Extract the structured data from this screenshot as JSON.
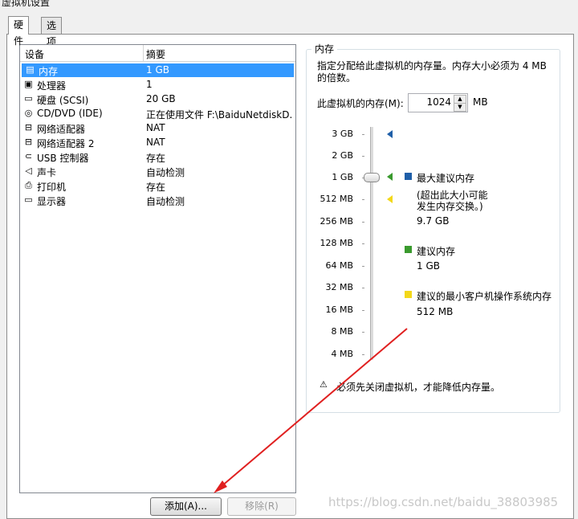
{
  "window": {
    "title": "虚拟机设置"
  },
  "tabs": [
    {
      "label": "硬件",
      "active": true
    },
    {
      "label": "选项",
      "active": false
    }
  ],
  "device_list": {
    "headers": {
      "device": "设备",
      "summary": "摘要"
    },
    "rows": [
      {
        "icon": "memory-icon",
        "name": "内存",
        "summary": "1 GB",
        "selected": true
      },
      {
        "icon": "processor-icon",
        "name": "处理器",
        "summary": "1"
      },
      {
        "icon": "hard-disk-icon",
        "name": "硬盘 (SCSI)",
        "summary": "20 GB"
      },
      {
        "icon": "cd-dvd-icon",
        "name": "CD/DVD (IDE)",
        "summary": "正在使用文件 F:\\BaiduNetdiskD..."
      },
      {
        "icon": "network-adapter-icon",
        "name": "网络适配器",
        "summary": "NAT"
      },
      {
        "icon": "network-adapter-icon",
        "name": "网络适配器 2",
        "summary": "NAT"
      },
      {
        "icon": "usb-icon",
        "name": "USB 控制器",
        "summary": "存在"
      },
      {
        "icon": "speaker-icon",
        "name": "声卡",
        "summary": "自动检测"
      },
      {
        "icon": "printer-icon",
        "name": "打印机",
        "summary": "存在"
      },
      {
        "icon": "monitor-icon",
        "name": "显示器",
        "summary": "自动检测"
      }
    ]
  },
  "buttons": {
    "add": "添加(A)...",
    "remove": "移除(R)"
  },
  "memory": {
    "group_title": "内存",
    "description_line1": "指定分配给此虚拟机的内存量。内存大小必须为 4 MB",
    "description_line2": "的倍数。",
    "field_label": "此虚拟机的内存(M):",
    "value": "1024",
    "unit": "MB",
    "scale_labels": [
      "3 GB",
      "2 GB",
      "1 GB",
      "512 MB",
      "256 MB",
      "128 MB",
      "64 MB",
      "32 MB",
      "16 MB",
      "8 MB",
      "4 MB"
    ],
    "max_recommended": {
      "label": "最大建议内存",
      "note_line1": "(超出此大小可能",
      "note_line2": "发生内存交换。)",
      "value": "9.7 GB",
      "color": "#1f5fa8"
    },
    "recommended": {
      "label": "建议内存",
      "value": "1 GB",
      "color": "#3a9a2e"
    },
    "min_guest": {
      "label": "建议的最小客户机操作系统内存",
      "value": "512 MB",
      "color": "#f3d81a"
    },
    "warning": "必须先关闭虚拟机，才能降低内存量。"
  },
  "watermark": "https://blog.csdn.net/baidu_38803985"
}
